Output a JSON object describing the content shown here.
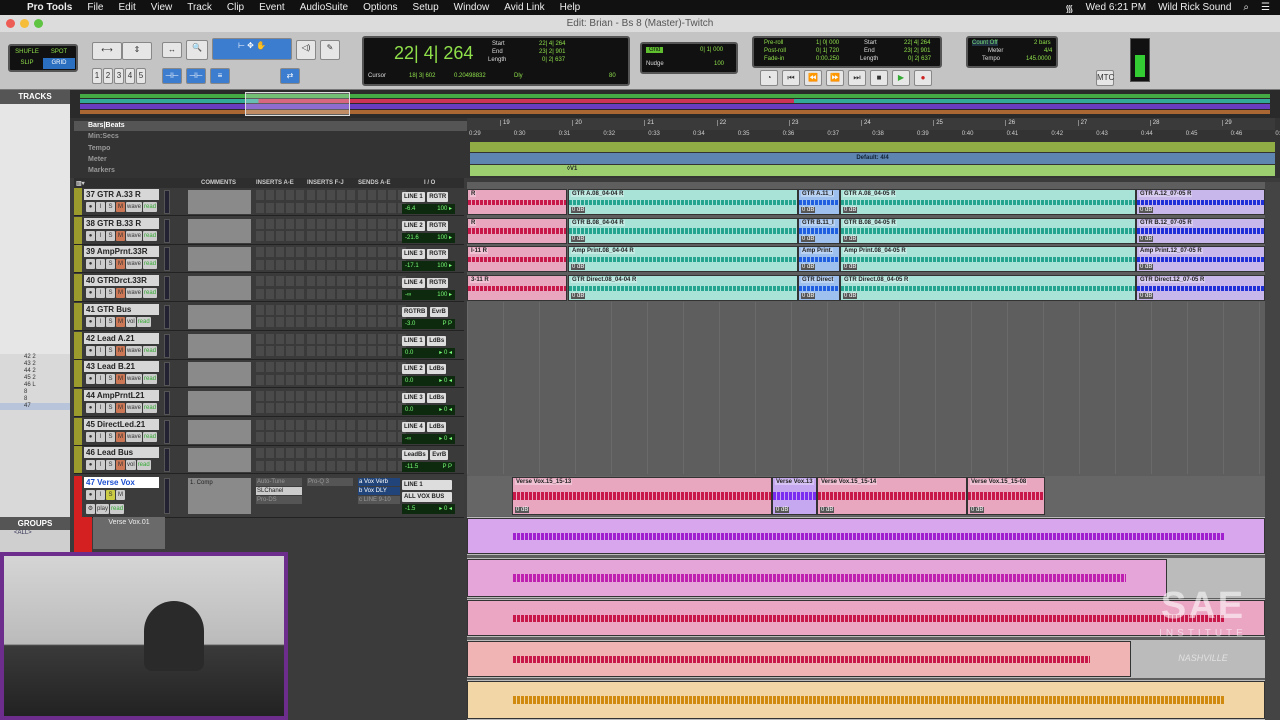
{
  "menubar": {
    "app": "Pro Tools",
    "items": [
      "File",
      "Edit",
      "View",
      "Track",
      "Clip",
      "Event",
      "AudioSuite",
      "Options",
      "Setup",
      "Window",
      "Avid Link",
      "Help"
    ],
    "clock": "Wed 6:21 PM",
    "user": "Wild Rick Sound"
  },
  "window": {
    "title": "Edit: Brian - Bs 8 (Master)-Twitch"
  },
  "toolbar": {
    "modes": [
      "SHUFLE",
      "SPOT",
      "SLIP",
      "GRID"
    ],
    "zoom_presets": [
      "1",
      "2",
      "3",
      "4",
      "5"
    ],
    "main_counter": "22| 4| 264",
    "start_label": "Start",
    "end_label": "End",
    "length_label": "Length",
    "start": "22| 4| 264",
    "end": "23| 2| 901",
    "length": "0| 2| 637",
    "cursor_label": "Cursor",
    "cursor": "18| 3| 602",
    "cursor_value": "0.20498832",
    "dly": "Dly",
    "tempo_val": "80",
    "grid_label": "Grid",
    "grid": "0| 1| 000",
    "nudge_label": "Nudge",
    "nudge": "100",
    "preroll_label": "Pre-roll",
    "preroll": "1| 0| 000",
    "postroll_label": "Post-roll",
    "postroll": "0| 1| 720",
    "fadein_label": "Fade-in",
    "fadein": "0:00.250",
    "countoff_label": "Count Off",
    "countoff": "2 bars",
    "meter_label": "Meter",
    "meter": "4/4",
    "tempo_label": "Tempo",
    "tempo": "145.0000",
    "mtc": "MTC"
  },
  "tracklist": {
    "header": "TRACKS",
    "rows": [
      "42 2",
      "43 2",
      "44 2",
      "45 2",
      "46 L",
      "8",
      "8",
      "47"
    ],
    "groups_header": "GROUPS",
    "groups_item": "<ALL>"
  },
  "rulers": {
    "labels": [
      "Bars|Beats",
      "Min:Secs",
      "Tempo",
      "Meter",
      "Markers"
    ],
    "bars": [
      "19",
      "20",
      "21",
      "22",
      "23",
      "24",
      "25",
      "26",
      "27",
      "28",
      "29"
    ],
    "secs": [
      "0:29",
      "0:30",
      "0:31",
      "0:32",
      "0:33",
      "0:34",
      "0:35",
      "0:36",
      "0:37",
      "0:38",
      "0:39",
      "0:40",
      "0:41",
      "0:42",
      "0:43",
      "0:44",
      "0:45",
      "0:46",
      "0:47"
    ],
    "meter_text": "Default: 4/4",
    "marker": "V1"
  },
  "columns": [
    "COMMENTS",
    "INSERTS A-E",
    "INSERTS F-J",
    "SENDS A-E",
    "I / O"
  ],
  "tracks": [
    {
      "name": "37  GTR A.33 R",
      "in": "LINE 1",
      "out": "RGTR",
      "vol": "-6.4",
      "pan": "100 ▸",
      "rw": "wave"
    },
    {
      "name": "38  GTR B.33 R",
      "in": "LINE 2",
      "out": "RGTR",
      "vol": "-21.6",
      "pan": "100 ▸",
      "rw": "wave"
    },
    {
      "name": "39  AmpPrnt.33R",
      "in": "LINE 3",
      "out": "RGTR",
      "vol": "-17.1",
      "pan": "100 ▸",
      "rw": "wave"
    },
    {
      "name": "40  GTRDrct.33R",
      "in": "LINE 4",
      "out": "RGTR",
      "vol": "-∞",
      "pan": "100 ▸",
      "rw": "wave"
    },
    {
      "name": "41    GTR Bus",
      "in": "RGTRB",
      "out": "EvrB",
      "vol": "-3.0",
      "pan": "P  P",
      "rw": "vol"
    },
    {
      "name": "42   Lead A.21",
      "in": "LINE 1",
      "out": "LdBs",
      "vol": "0.0",
      "pan": "▸ 0 ◂",
      "rw": "wave"
    },
    {
      "name": "43   Lead B.21",
      "in": "LINE 2",
      "out": "LdBs",
      "vol": "0.0",
      "pan": "▸ 0 ◂",
      "rw": "wave"
    },
    {
      "name": "44  AmpPrntL21",
      "in": "LINE 3",
      "out": "LdBs",
      "vol": "0.0",
      "pan": "▸ 0 ◂",
      "rw": "wave"
    },
    {
      "name": "45  DirectLed.21",
      "in": "LINE 4",
      "out": "LdBs",
      "vol": "-∞",
      "pan": "▸ 0 ◂",
      "rw": "wave"
    },
    {
      "name": "46    Lead Bus",
      "in": "LeadBs",
      "out": "EvrB",
      "vol": "-11.5",
      "pan": "P  P",
      "rw": "vol"
    }
  ],
  "selected_track": {
    "name": "47  Verse Vox",
    "comment": "1. Comp",
    "inserts": [
      "Auto-Tune",
      "SLChanel",
      "Pro-DS"
    ],
    "inserts_fj": [
      "Pro-Q 3"
    ],
    "sends": [
      "a  Vox Verb",
      "b  Vox DLY",
      "c  LINE 9-10"
    ],
    "in": "LINE 1",
    "out": "ALL VOX BUS",
    "vol": "-1.5",
    "pan": "▸ 0 ◂",
    "rw": "play",
    "playlist": "Verse Vox.01"
  },
  "clips": {
    "row1": [
      "R",
      "GTR A.08_04-04 R",
      "GTR A.11_I",
      "GTR A.08_04-05 R",
      "GTR A.12_07-05 R"
    ],
    "row2": [
      "R",
      "GTR B.08_04-04 R",
      "GTR B.11_I",
      "GTR B.08_04-05 R",
      "GTR B.12_07-05 R"
    ],
    "row3": [
      "I-11 R",
      "Amp Print.08_04-04 R",
      "Amp Print.",
      "Amp Print.08_04-05 R",
      "Amp Print.12_07-05 R"
    ],
    "row4": [
      "3-11 R",
      "GTR Direct.08_04-04 R",
      "GTR Direct",
      "GTR Direct.08_04-05 R",
      "GTR Direct.12_07-05 R"
    ],
    "vox": [
      "Verse Vox.15_15-13",
      "Verse Vox.13",
      "Verse Vox.15_15-14",
      "Verse Vox.15_15-08"
    ],
    "gain": "0 dB"
  },
  "logo": {
    "text": "SAE",
    "sub": "INSTITUTE",
    "city": "NASHVILLE"
  }
}
